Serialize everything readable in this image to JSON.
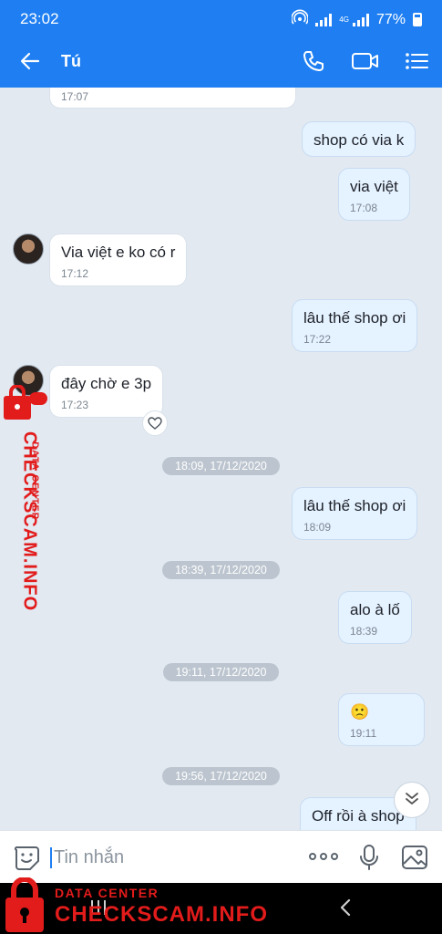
{
  "status_bar": {
    "time": "23:02",
    "network": "4G",
    "battery": "77%"
  },
  "header": {
    "title": "Tú"
  },
  "messages": [
    {
      "side": "them",
      "text": "",
      "time": "17:07"
    },
    {
      "side": "me",
      "text": "shop có via k",
      "time": ""
    },
    {
      "side": "me",
      "text": "via việt",
      "time": "17:08"
    },
    {
      "side": "them",
      "text": "Via việt e ko có r",
      "time": "17:12"
    },
    {
      "side": "me",
      "text": "lâu thế shop ơi",
      "time": "17:22"
    },
    {
      "side": "them",
      "text": "đây chờ e 3p",
      "time": "17:23"
    },
    {
      "side": "me",
      "text": "lâu thế shop ơi",
      "time": "18:09"
    },
    {
      "side": "me",
      "text": "alo à lố",
      "time": "18:39"
    },
    {
      "side": "me",
      "text": "🙁",
      "time": "19:11"
    },
    {
      "side": "me",
      "text": "Off rồi à shop",
      "time": ""
    }
  ],
  "separators": [
    "18:09, 17/12/2020",
    "18:39, 17/12/2020",
    "19:11, 17/12/2020",
    "19:56, 17/12/2020"
  ],
  "input": {
    "placeholder": "Tin nhắn"
  },
  "watermark": {
    "label": "DATA CENTER",
    "brand": "CHECKSCAM.INFO",
    "color": "#e21b1b"
  },
  "colors": {
    "accent": "#1f7ff2",
    "my_bubble": "#e5f2ff",
    "their_bubble": "#ffffff",
    "chat_bg": "#e2e9f1"
  },
  "icons": [
    "back-arrow-icon",
    "phone-icon",
    "video-call-icon",
    "list-menu-icon",
    "sticker-icon",
    "more-dots-icon",
    "microphone-icon",
    "image-icon",
    "chevron-double-down-icon",
    "heart-icon",
    "lock-icon"
  ]
}
